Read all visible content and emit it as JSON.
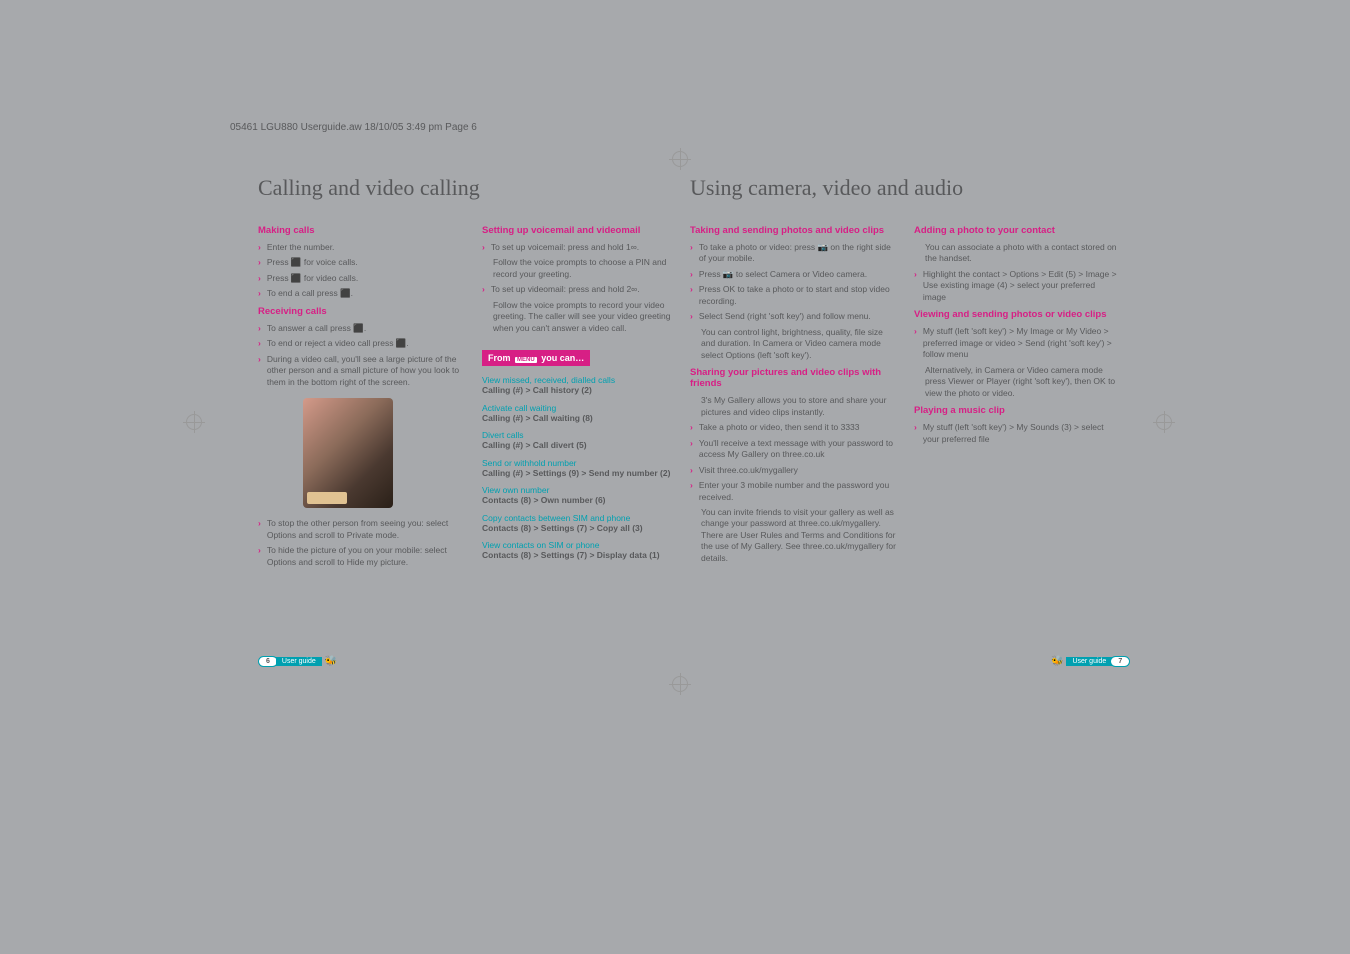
{
  "header": "05461 LGU880 Userguide.aw  18/10/05  3:49 pm  Page 6",
  "leftPage": {
    "title": "Calling and video calling",
    "col1": {
      "making": {
        "heading": "Making calls",
        "items": [
          "Enter the number.",
          "Press ⬛ for voice calls.",
          "Press ⬛ for video calls.",
          "To end a call press ⬛."
        ]
      },
      "receiving": {
        "heading": "Receiving calls",
        "items": [
          "To answer a call press ⬛.",
          "To end or reject a video call press ⬛.",
          "During a video call, you'll see a large picture of the other person and a small picture of how you look to them in the bottom right of the screen."
        ],
        "after": [
          "To stop the other person from seeing you: select Options and scroll to Private mode.",
          "To hide the picture of you on your mobile: select Options and scroll to Hide my picture."
        ]
      }
    },
    "col2": {
      "setup": {
        "heading": "Setting up voicemail and videomail",
        "items": [
          "To set up voicemail: press and hold 1∞.",
          "Follow the voice prompts to choose a PIN and record your greeting.",
          "To set up videomail: press and hold 2∞.",
          "Follow the voice prompts to record your video greeting. The caller will see your video greeting when you can't answer a video call."
        ]
      },
      "fromMenu": {
        "label": "From MENU you can…",
        "groups": [
          {
            "sub": "View missed, received, dialled calls",
            "bold": "Calling (#) > Call history (2)"
          },
          {
            "sub": "Activate call waiting",
            "bold": "Calling (#) > Call waiting (8)"
          },
          {
            "sub": "Divert calls",
            "bold": "Calling (#) > Call divert (5)"
          },
          {
            "sub": "Send or withhold number",
            "bold": "Calling (#) > Settings (9) > Send my number (2)"
          },
          {
            "sub": "View own number",
            "bold": "Contacts (8) > Own number (6)"
          },
          {
            "sub": "Copy contacts between SIM and phone",
            "bold": "Contacts (8) > Settings (7) > Copy all  (3)"
          },
          {
            "sub": "View contacts on SIM or phone",
            "bold": "Contacts (8) > Settings (7) > Display data  (1)"
          }
        ]
      }
    }
  },
  "rightPage": {
    "title": "Using camera, video and audio",
    "col1": {
      "taking": {
        "heading": "Taking and sending photos and video clips",
        "items": [
          "To take a photo or video: press 📷 on the right side of your mobile.",
          "Press 📷 to select Camera or Video camera.",
          "Press OK to take a photo or to start and stop video recording.",
          "Select Send (right 'soft key') and follow menu."
        ],
        "note": "You can control light, brightness, quality, file size and duration. In Camera or Video camera mode select Options (left 'soft key')."
      },
      "sharing": {
        "heading": "Sharing your pictures and video clips with friends",
        "intro": "3's My Gallery allows you to store and share your pictures and video clips instantly.",
        "items": [
          "Take a photo or video, then send it to 3333",
          "You'll receive a text message with your password to access My Gallery on three.co.uk",
          "Visit three.co.uk/mygallery",
          "Enter your 3 mobile number and the password you received."
        ],
        "note": "You can invite friends to visit your gallery as well as change your password at three.co.uk/mygallery. There are User Rules and Terms and Conditions for the use of My Gallery. See three.co.uk/mygallery for details."
      }
    },
    "col2": {
      "adding": {
        "heading": "Adding a photo to your contact",
        "intro": "You can associate a photo with a contact stored on the handset.",
        "items": [
          "Highlight the contact > Options > Edit (5) > Image > Use existing image (4) > select your preferred image"
        ]
      },
      "viewing": {
        "heading": "Viewing and sending photos or video clips",
        "items": [
          "My stuff (left 'soft key') > My Image or My Video > preferred image or video > Send (right 'soft key') > follow menu"
        ],
        "note": "Alternatively, in Camera or Video camera mode press Viewer or Player (right 'soft key'), then OK to view the photo or video."
      },
      "playing": {
        "heading": "Playing a music clip",
        "items": [
          "My stuff (left 'soft key') > My Sounds (3) > select your preferred file"
        ]
      }
    }
  },
  "footer": {
    "leftNum": "6",
    "leftText": "User guide",
    "rightText": "User guide",
    "rightNum": "7"
  }
}
